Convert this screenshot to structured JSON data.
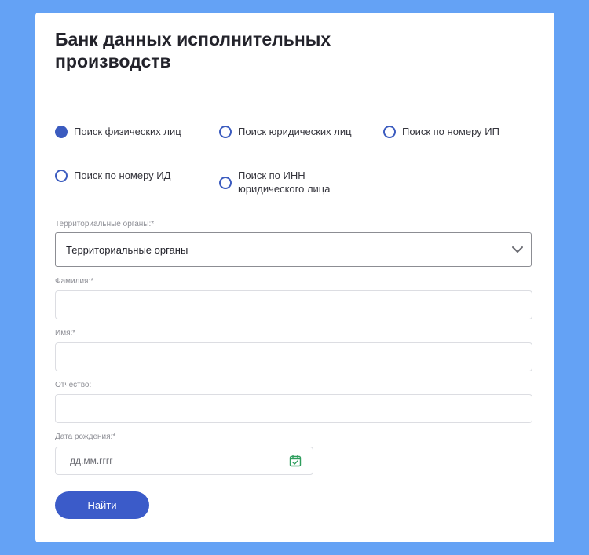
{
  "page": {
    "title": "Банк данных исполнительных производств"
  },
  "search_types": [
    {
      "label": "Поиск физических лиц",
      "checked": true
    },
    {
      "label": "Поиск юридических лиц",
      "checked": false
    },
    {
      "label": "Поиск по номеру ИП",
      "checked": false
    },
    {
      "label": "Поиск по номеру ИД",
      "checked": false
    },
    {
      "label": "Поиск по ИНН юридического лица",
      "checked": false
    }
  ],
  "form": {
    "territorial": {
      "label": "Территориальные органы:*",
      "selected": "Территориальные органы"
    },
    "last_name": {
      "label": "Фамилия:*",
      "value": ""
    },
    "first_name": {
      "label": "Имя:*",
      "value": ""
    },
    "patronymic": {
      "label": "Отчество:",
      "value": ""
    },
    "birth_date": {
      "label": "Дата рождения:*",
      "placeholder": "дд.мм.гггг",
      "value": ""
    },
    "submit_label": "Найти"
  },
  "colors": {
    "background": "#64a2f5",
    "accent": "#3b5bc9",
    "calendar_icon": "#2f9e5e"
  }
}
